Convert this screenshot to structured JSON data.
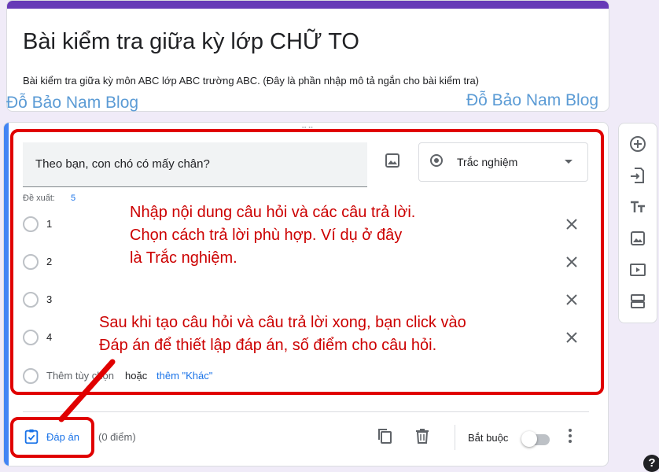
{
  "form": {
    "title": "Bài kiểm tra giữa kỳ lớp CHỮ TO",
    "description": "Bài kiểm tra giữa kỳ môn ABC lớp ABC trường ABC. (Đây là phần nhập mô tả ngắn cho bài kiểm tra)"
  },
  "watermarks": [
    "Đỗ Bảo Nam Blog",
    "Đỗ Bảo Nam Blog"
  ],
  "question": {
    "text": "Theo bạn, con chó có mấy chân?",
    "type": "Trắc nghiệm",
    "suggest_label": "Đề xuất:",
    "suggest_count": "5",
    "options": [
      {
        "label": "1"
      },
      {
        "label": "2"
      },
      {
        "label": "3"
      },
      {
        "label": "4"
      }
    ],
    "add_option": "Thêm tùy chọn",
    "or_label": "hoặc",
    "add_other": "thêm \"Khác\""
  },
  "footer": {
    "answer_key_label": "Đáp án",
    "points_label": "(0 điểm)",
    "required_label": "Bắt buộc",
    "required": false
  },
  "annotations": {
    "note1_line1": "Nhập nội dung câu hỏi và các câu trả lời.",
    "note1_line2": "Chọn cách trả lời phù hợp. Ví dụ ở đây",
    "note1_line3": "là Trắc nghiệm.",
    "note2_line1": "Sau khi tạo câu hỏi và câu trả lời xong, bạn click vào",
    "note2_line2": "Đáp án để thiết lập đáp án, số điểm cho câu hỏi."
  },
  "side_toolbar": [
    "add-question-icon",
    "import-questions-icon",
    "add-title-icon",
    "add-image-icon",
    "add-video-icon",
    "add-section-icon"
  ],
  "help_glyph": "?",
  "colors": {
    "theme": "#673ab7",
    "background": "#f0ebf8",
    "accent": "#1a73e8",
    "annotation": "#e00000",
    "watermark": "#5b9bd5"
  }
}
